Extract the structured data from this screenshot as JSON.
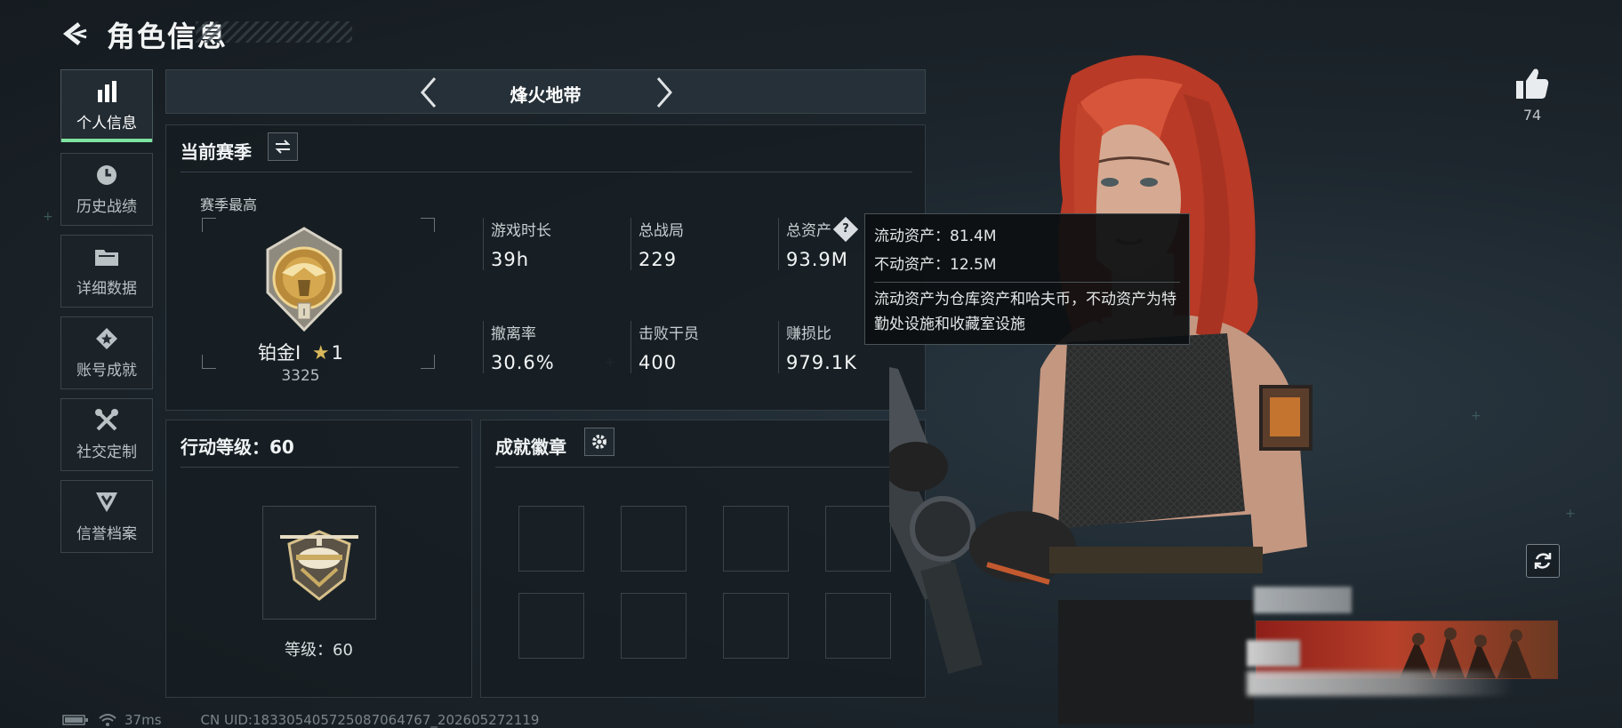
{
  "header": {
    "title": "角色信息"
  },
  "sidebar": {
    "items": [
      {
        "label": "个人信息",
        "icon": "bar-chart-icon",
        "active": true
      },
      {
        "label": "历史战绩",
        "icon": "history-clock-icon",
        "active": false
      },
      {
        "label": "详细数据",
        "icon": "folder-icon",
        "active": false
      },
      {
        "label": "账号成就",
        "icon": "achievement-star-icon",
        "active": false
      },
      {
        "label": "社交定制",
        "icon": "tools-icon",
        "active": false
      },
      {
        "label": "信誉档案",
        "icon": "shield-arrow-icon",
        "active": false
      }
    ]
  },
  "mode": {
    "name": "烽火地带"
  },
  "season": {
    "title": "当前赛季",
    "best_label": "赛季最高",
    "rank_name": "铂金I",
    "rank_stars": "1",
    "rank_score": "3325",
    "stats": [
      {
        "label": "游戏时长",
        "value": "39h"
      },
      {
        "label": "总战局",
        "value": "229"
      },
      {
        "label": "总资产",
        "value": "93.9M"
      },
      {
        "label": "撤离率",
        "value": "30.6%"
      },
      {
        "label": "击败干员",
        "value": "400"
      },
      {
        "label": "赚损比",
        "value": "979.1K"
      }
    ]
  },
  "tooltip": {
    "liquid": "流动资产：81.4M",
    "fixed": "不动资产：12.5M",
    "description": "流动资产为仓库资产和哈夫币，不动资产为特勤处设施和收藏室设施"
  },
  "level": {
    "title": "行动等级：60",
    "text": "等级：60"
  },
  "achievements": {
    "title": "成就徽章",
    "slot_count": 8
  },
  "likes": {
    "count": "74"
  },
  "footer": {
    "ping": "37ms",
    "uid": "CN UID:183305405725087064767_202605272119"
  },
  "colors": {
    "accent": "#7de3a0",
    "background": "#1a2127",
    "hair": "#c8432c"
  }
}
